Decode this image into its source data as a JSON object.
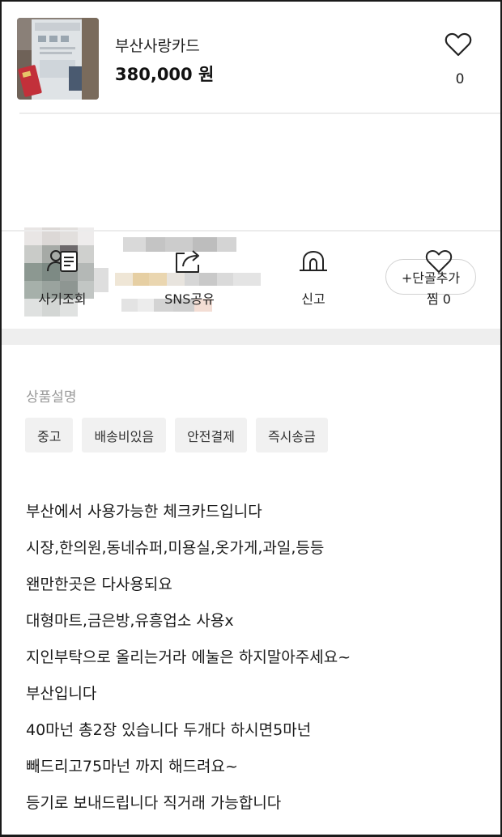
{
  "product": {
    "title": "부산사랑카드",
    "price": "380,000 원",
    "like_count": "0",
    "thumbnail_icon": "card-photo"
  },
  "seller": {
    "follow_label": "+단골추가"
  },
  "actions": [
    {
      "label": "사기조회",
      "icon": "fraud-check-icon"
    },
    {
      "label": "SNS공유",
      "icon": "share-icon"
    },
    {
      "label": "신고",
      "icon": "siren-icon"
    },
    {
      "label": "찜 0",
      "icon": "heart-icon"
    }
  ],
  "description": {
    "section_title": "상품설명",
    "tags": [
      "중고",
      "배송비있음",
      "안전결제",
      "즉시송금"
    ],
    "lines": [
      "부산에서 사용가능한 체크카드입니다",
      "시장,한의원,동네슈퍼,미용실,옷가게,과일,등등",
      "왠만한곳은 다사용되요",
      "대형마트,금은방,유흥업소 사용x",
      "지인부탁으로 올리는거라 에눌은 하지말아주세요~",
      "부산입니다",
      "40마넌 총2장 있습니다 두개다 하시면5마넌",
      "빼드리고75마넌 까지 해드려요~",
      "등기로 보내드립니다 직거래 가능합니다"
    ]
  },
  "colors": {
    "text": "#222222",
    "muted": "#9a9a9a",
    "tag_bg": "#f1f1f1",
    "band": "#eeeeee"
  }
}
